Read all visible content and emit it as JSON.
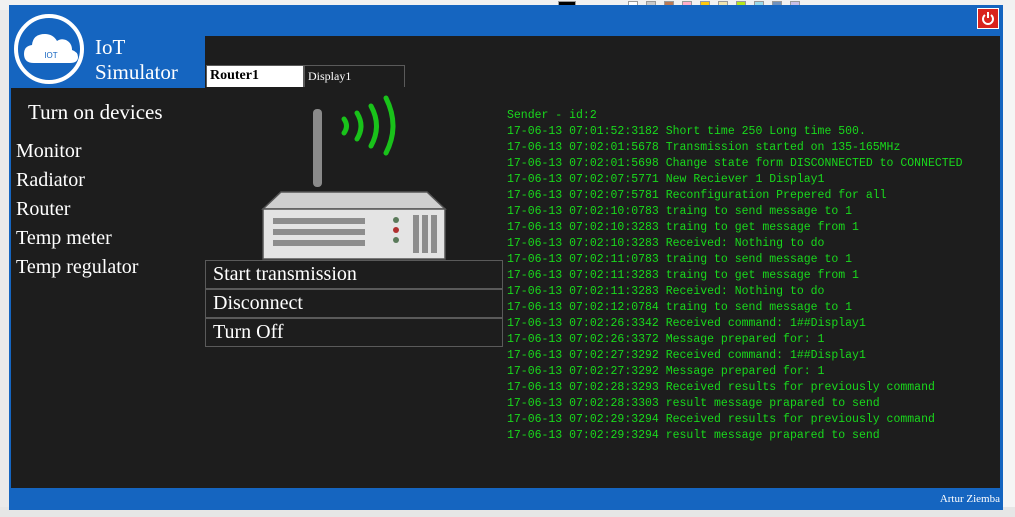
{
  "app": {
    "logo_text": "IOT",
    "title_line1": "IoT",
    "title_line2": "Simulator"
  },
  "colors": {
    "accent": "#1565c0",
    "panel": "#1d1d1d",
    "log_text": "#19d91c",
    "power": "#d9231d"
  },
  "header": {
    "power_icon": "power-icon"
  },
  "tabs": [
    {
      "label": "Router1",
      "active": true
    },
    {
      "label": "Display1",
      "active": false
    }
  ],
  "sidebar": {
    "title": "Turn on devices",
    "devices": [
      {
        "label": "Monitor"
      },
      {
        "label": "Radiator"
      },
      {
        "label": "Router"
      },
      {
        "label": "Temp meter"
      },
      {
        "label": "Temp regulator"
      }
    ]
  },
  "device_panel": {
    "image_icon": "router-icon",
    "actions": [
      {
        "label": "Start transmission"
      },
      {
        "label": "Disconnect"
      },
      {
        "label": "Turn Off"
      }
    ]
  },
  "log": {
    "lines": [
      "Sender - id:2",
      "17-06-13 07:01:52:3182 Short time 250 Long time 500.",
      "17-06-13 07:02:01:5678 Transmission started on 135-165MHz",
      "17-06-13 07:02:01:5698 Change state form DISCONNECTED to CONNECTED",
      "17-06-13 07:02:07:5771 New Reciever 1 Display1",
      "17-06-13 07:02:07:5781 Reconfiguration Prepered for all",
      "17-06-13 07:02:10:0783 traing to send message to 1",
      "17-06-13 07:02:10:3283 traing to get message from 1",
      "17-06-13 07:02:10:3283 Received: Nothing to do",
      "17-06-13 07:02:11:0783 traing to send message to 1",
      "17-06-13 07:02:11:3283 traing to get message from 1",
      "17-06-13 07:02:11:3283 Received: Nothing to do",
      "17-06-13 07:02:12:0784 traing to send message to 1",
      "17-06-13 07:02:26:3342 Received command: 1##Display1",
      "17-06-13 07:02:26:3372 Message prepared for: 1",
      "17-06-13 07:02:27:3292 Received command: 1##Display1",
      "17-06-13 07:02:27:3292 Message prepared for: 1",
      "17-06-13 07:02:28:3293 Received results for previously command",
      "17-06-13 07:02:28:3303 result message prapared to send",
      "17-06-13 07:02:29:3294 Received results for previously command",
      "17-06-13 07:02:29:3294 result message prapared to send"
    ]
  },
  "status_bar": {
    "author": "Artur Ziemba"
  }
}
